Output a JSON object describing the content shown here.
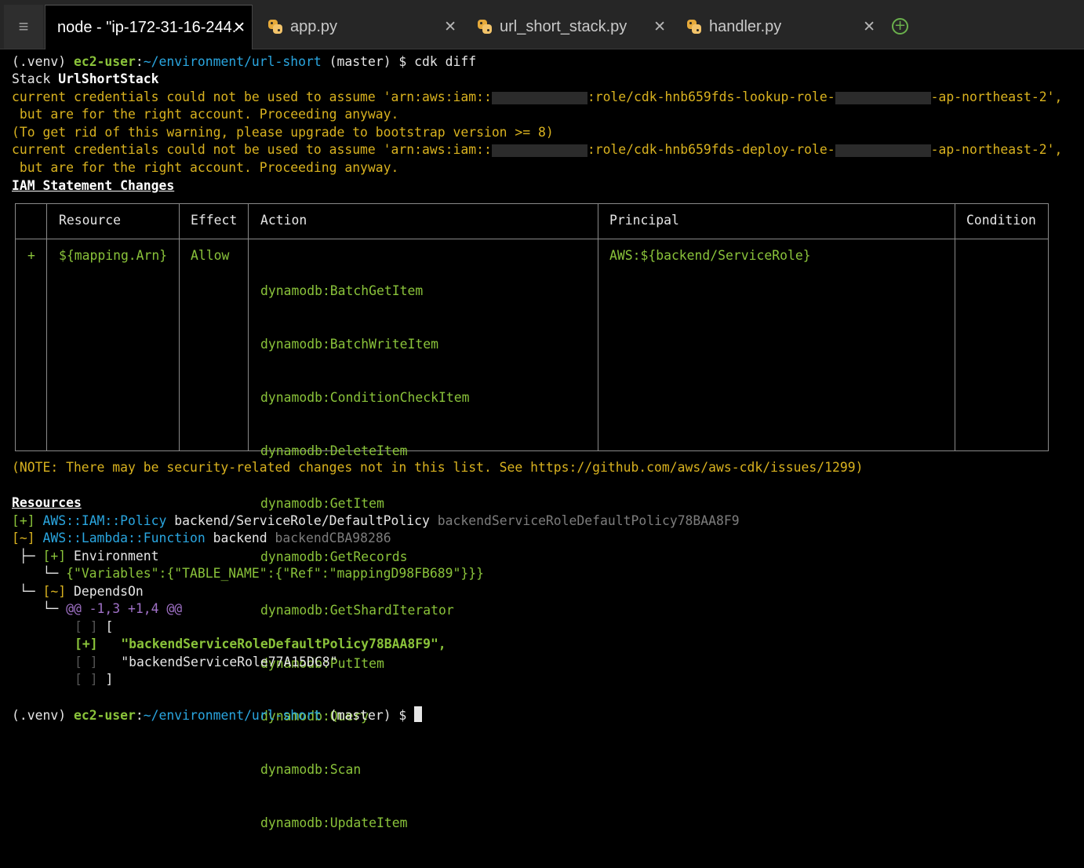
{
  "tabs": [
    {
      "label": "node - \"ip-172-31-16-244.",
      "active": true
    },
    {
      "label": "app.py",
      "active": false
    },
    {
      "label": "url_short_stack.py",
      "active": false
    },
    {
      "label": "handler.py",
      "active": false
    }
  ],
  "tab_close_glyph": "✕",
  "menu_glyph": "≡",
  "add_tab_glyph": "+",
  "prompt": {
    "venv": "(.venv) ",
    "user": "ec2-user",
    "colon": ":",
    "path": "~/environment/url-short",
    "branch": " (master) $ ",
    "command": "cdk diff"
  },
  "stack_line": {
    "prefix": "Stack ",
    "name": "UrlShortStack"
  },
  "warnings": {
    "w1a": "current credentials could not be used to assume 'arn:aws:iam::",
    "w1b": ":role/cdk-hnb659fds-lookup-role-",
    "w1c": "-ap-northeast-2',",
    "w1d": " but are for the right account. Proceeding anyway.",
    "w2": "(To get rid of this warning, please upgrade to bootstrap version >= 8)",
    "w3a": "current credentials could not be used to assume 'arn:aws:iam::",
    "w3b": ":role/cdk-hnb659fds-deploy-role-",
    "w3c": "-ap-northeast-2',",
    "w3d": " but are for the right account. Proceeding anyway."
  },
  "iam_heading": "IAM Statement Changes",
  "iam_table": {
    "headers": [
      "",
      "Resource",
      "Effect",
      "Action",
      "Principal",
      "Condition"
    ],
    "row": {
      "marker": "+",
      "resource": "${mapping.Arn}",
      "effect": "Allow",
      "actions": [
        "dynamodb:BatchGetItem",
        "dynamodb:BatchWriteItem",
        "dynamodb:ConditionCheckItem",
        "dynamodb:DeleteItem",
        "dynamodb:GetItem",
        "dynamodb:GetRecords",
        "dynamodb:GetShardIterator",
        "dynamodb:PutItem",
        "dynamodb:Query",
        "dynamodb:Scan",
        "dynamodb:UpdateItem"
      ],
      "principal": "AWS:${backend/ServiceRole}",
      "condition": ""
    }
  },
  "note": "(NOTE: There may be security-related changes not in this list. See https://github.com/aws/aws-cdk/issues/1299)",
  "resources_heading": "Resources",
  "resources": {
    "r1": {
      "mark": "[+]",
      "type": "AWS::IAM::Policy",
      "name": "backend/ServiceRole/DefaultPolicy",
      "logical": "backendServiceRoleDefaultPolicy78BAA8F9"
    },
    "r2": {
      "mark": "[~]",
      "type": "AWS::Lambda::Function",
      "name": "backend",
      "logical": "backendCBA98286"
    },
    "env_branch": " ├─ ",
    "env_mark": "[+]",
    "env_label": "Environment",
    "env_leaf": "    └─ ",
    "env_value": "{\"Variables\":{\"TABLE_NAME\":{\"Ref\":\"mappingD98FB689\"}}}",
    "dep_branch": " └─ ",
    "dep_mark": "[~]",
    "dep_label": "DependsOn",
    "dep_leaf": "    └─ ",
    "dep_hunk": "@@ -1,3 +1,4 @@",
    "diff": [
      {
        "mark": "[ ]",
        "text": "["
      },
      {
        "mark": "[+]",
        "text": "\"backendServiceRoleDefaultPolicy78BAA8F9\","
      },
      {
        "mark": "[ ]",
        "text": "\"backendServiceRole77A15DC8\""
      },
      {
        "mark": "[ ]",
        "text": "]"
      }
    ]
  }
}
